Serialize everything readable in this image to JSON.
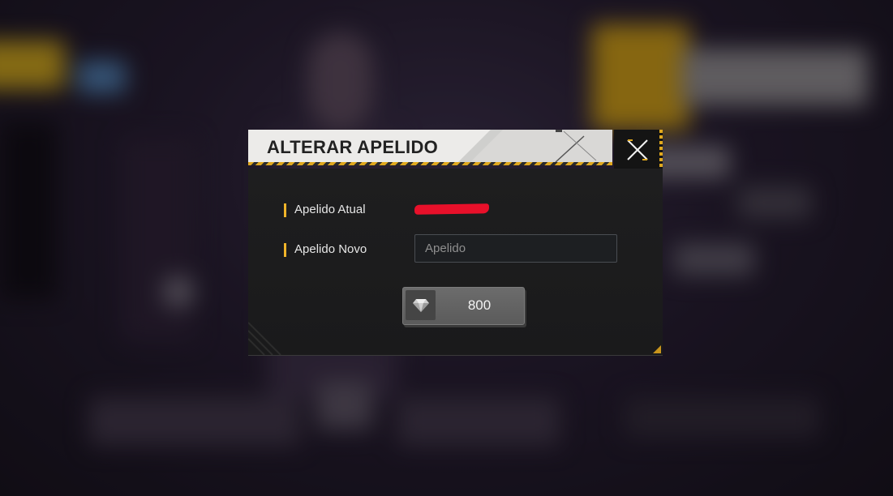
{
  "dialog": {
    "title": "ALTERAR APELIDO",
    "close_icon": "close-x-icon",
    "current_nickname_label": "Apelido Atual",
    "current_nickname_value": "",
    "new_nickname_label": "Apelido Novo",
    "new_nickname_placeholder": "Apelido",
    "new_nickname_value": "",
    "price": {
      "icon": "diamond-icon",
      "value": "800"
    }
  },
  "colors": {
    "accent": "#f0b429",
    "redaction": "#e8102a",
    "header_bg": "#ecebe9",
    "body_bg": "#1e1e1f"
  }
}
